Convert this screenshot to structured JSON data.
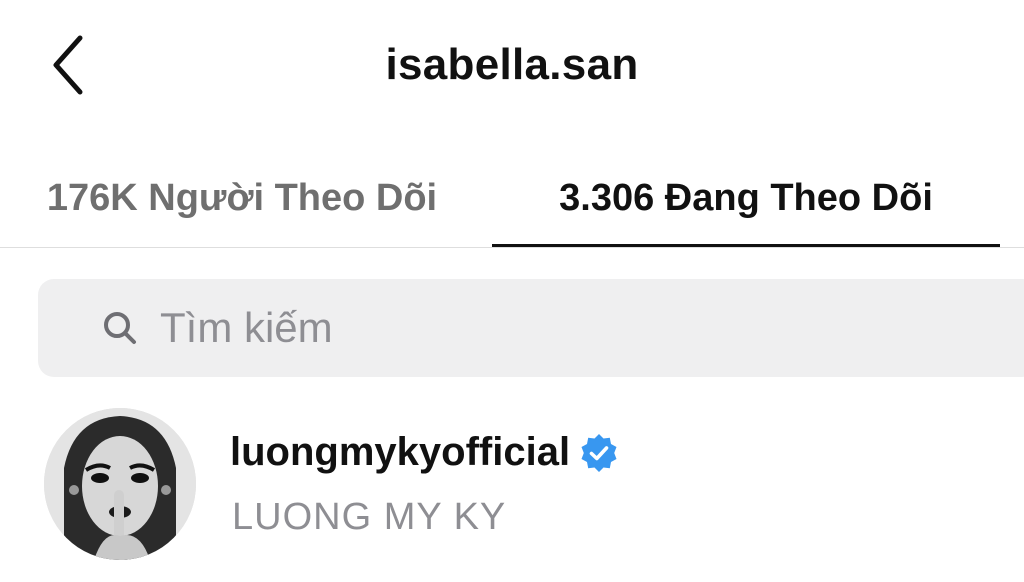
{
  "header": {
    "title": "isabella.san",
    "back_icon": "chevron-left-icon"
  },
  "tabs": [
    {
      "label": "176K Người Theo Dõi",
      "active": false
    },
    {
      "label": "3.306 Đang Theo Dõi",
      "active": true
    }
  ],
  "search": {
    "placeholder": "Tìm kiếm",
    "value": "",
    "icon": "search-icon"
  },
  "list": [
    {
      "username": "luongmykyofficial",
      "full_name": "LUONG MY KY",
      "verified": true,
      "verified_icon": "verified-badge-icon"
    }
  ],
  "colors": {
    "accent_verified": "#3897f0",
    "inactive_tab": "#6f6f6f",
    "secondary_text": "#8e8e93",
    "search_bg": "#efeff0"
  }
}
